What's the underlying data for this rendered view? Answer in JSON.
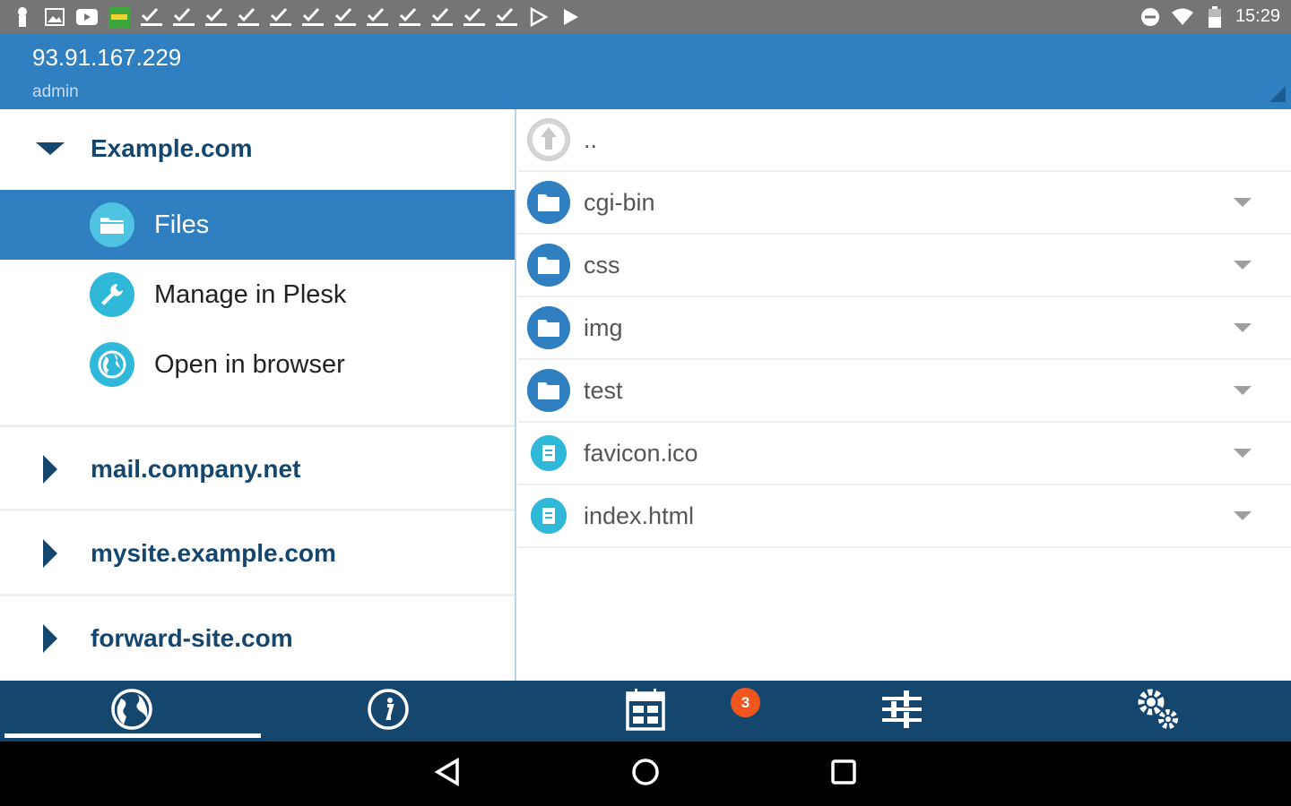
{
  "status_bar": {
    "time": "15:29",
    "left_icons": [
      "lock-icon",
      "image-icon",
      "youtube-icon",
      "app-icon",
      "check-icon",
      "check-icon",
      "check-icon",
      "check-icon",
      "check-icon",
      "check-icon",
      "check-icon",
      "check-icon",
      "check-icon",
      "check-icon",
      "check-icon",
      "check-icon",
      "play-store-icon",
      "play-store-icon"
    ],
    "right_icons": [
      "do-not-disturb-icon",
      "wifi-icon",
      "battery-icon"
    ]
  },
  "header": {
    "host": "93.91.167.229",
    "user": "admin"
  },
  "sidebar": {
    "expanded_site": "Example.com",
    "sub_items": [
      {
        "label": "Files",
        "icon": "folder-icon",
        "active": true
      },
      {
        "label": "Manage in Plesk",
        "icon": "wrench-icon",
        "active": false
      },
      {
        "label": "Open in browser",
        "icon": "globe-icon",
        "active": false
      }
    ],
    "collapsed_sites": [
      "mail.company.net",
      "mysite.example.com",
      "forward-site.com"
    ]
  },
  "files": {
    "parent": "..",
    "items": [
      {
        "name": "cgi-bin",
        "type": "folder"
      },
      {
        "name": "css",
        "type": "folder"
      },
      {
        "name": "img",
        "type": "folder"
      },
      {
        "name": "test",
        "type": "folder"
      },
      {
        "name": "favicon.ico",
        "type": "file"
      },
      {
        "name": "index.html",
        "type": "file"
      }
    ]
  },
  "bottom_tabs": {
    "items": [
      "globe-icon",
      "info-icon",
      "calendar-icon",
      "sliders-icon",
      "settings-gears-icon"
    ],
    "active_index": 0,
    "badge": "3"
  },
  "nav_bar": [
    "back-icon",
    "home-icon",
    "recents-icon"
  ],
  "colors": {
    "primary": "#2f7fc1",
    "dark": "#15466e",
    "accent": "#2fb8d8",
    "badge": "#f0561d"
  }
}
